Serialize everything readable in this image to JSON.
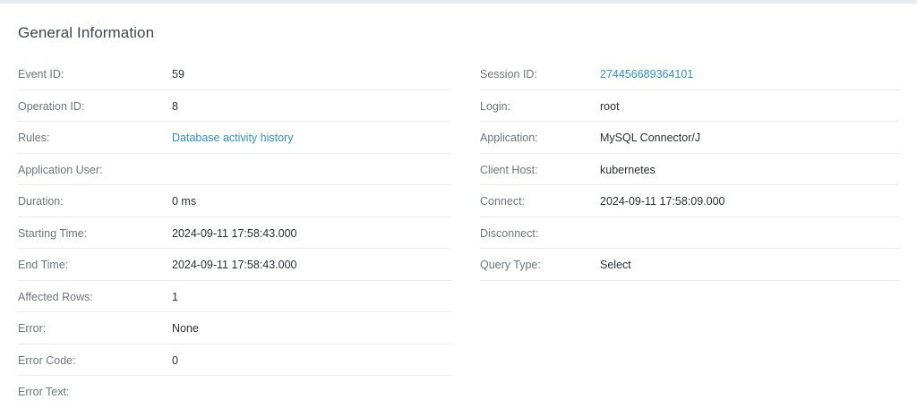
{
  "title": "General Information",
  "left_rows": [
    {
      "label": "Event ID:",
      "value": "59"
    },
    {
      "label": "Operation ID:",
      "value": "8"
    },
    {
      "label": "Rules:",
      "value": "Database activity history"
    },
    {
      "label": "Application User:",
      "value": ""
    },
    {
      "label": "Duration:",
      "value": "0 ms"
    },
    {
      "label": "Starting Time:",
      "value": "2024-09-11 17:58:43.000"
    },
    {
      "label": "End Time:",
      "value": "2024-09-11 17:58:43.000"
    },
    {
      "label": "Affected Rows:",
      "value": "1"
    },
    {
      "label": "Error:",
      "value": "None"
    },
    {
      "label": "Error Code:",
      "value": "0"
    },
    {
      "label": "Error Text:",
      "value": ""
    }
  ],
  "right_rows": [
    {
      "label": "Session ID:",
      "value": "274456689364101"
    },
    {
      "label": "Login:",
      "value": "root"
    },
    {
      "label": "Application:",
      "value": "MySQL Connector/J"
    },
    {
      "label": "Client Host:",
      "value": "kubernetes"
    },
    {
      "label": "Connect:",
      "value": "2024-09-11 17:58:09.000"
    },
    {
      "label": "Disconnect:",
      "value": ""
    },
    {
      "label": "Query Type:",
      "value": "Select"
    }
  ],
  "colors": {
    "link": "#2f8fd8",
    "label": "#6c7680",
    "divider": "#e9ecef"
  }
}
